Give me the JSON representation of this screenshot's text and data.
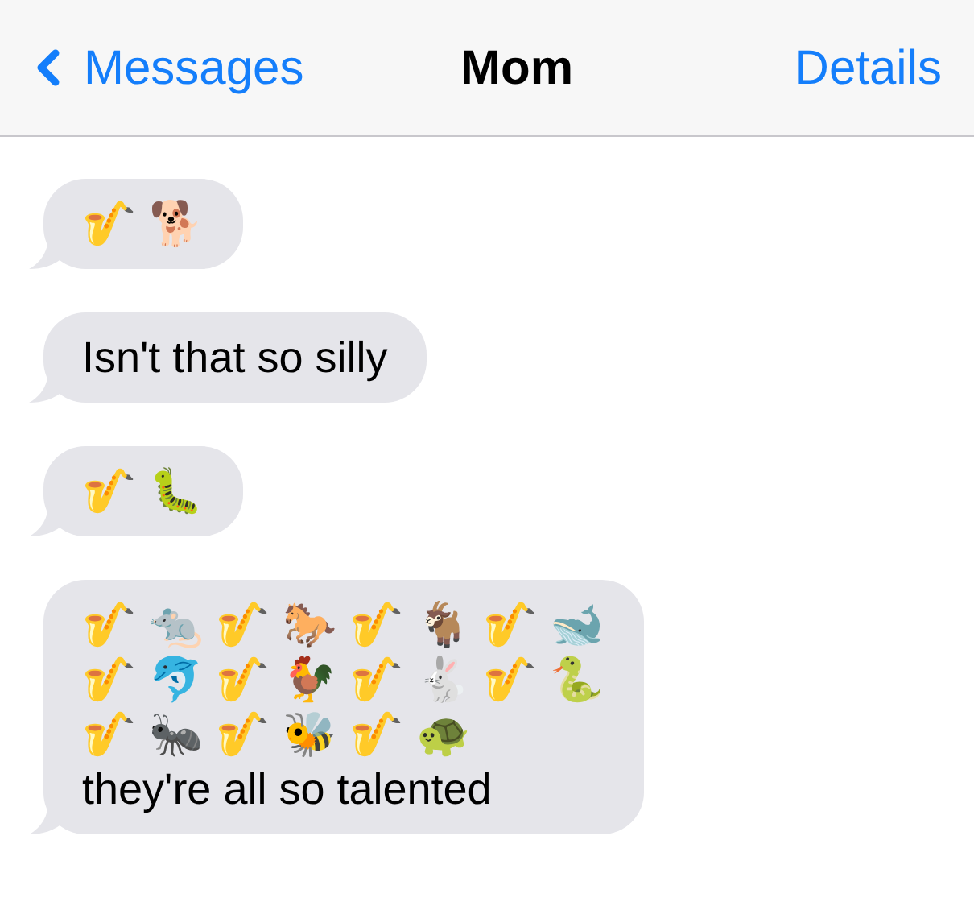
{
  "nav": {
    "back": "Messages",
    "title": "Mom",
    "action": "Details"
  },
  "messages": [
    {
      "lines": [
        "🎷 🐕"
      ]
    },
    {
      "lines": [
        "Isn't that so silly"
      ]
    },
    {
      "lines": [
        "🎷 🐛"
      ]
    },
    {
      "lines": [
        "🎷 🐀 🎷 🐎 🎷 🐐 🎷 🐋",
        "🎷 🐬 🎷 🐓 🎷 🐇 🎷 🐍",
        "🎷 🐜 🎷 🐝 🎷 🐢",
        "they're all so talented"
      ]
    }
  ]
}
